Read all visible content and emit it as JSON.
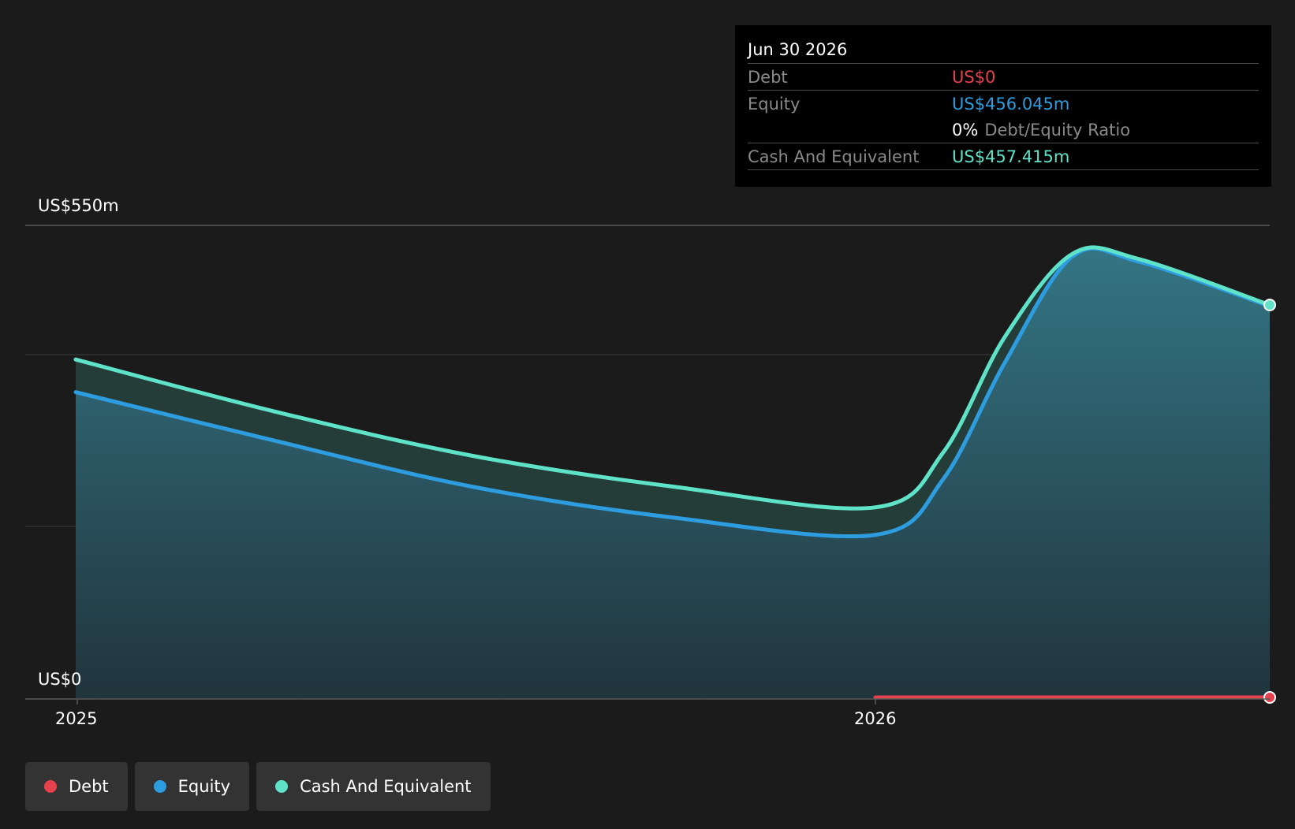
{
  "tooltip": {
    "date": "Jun 30 2026",
    "debt_label": "Debt",
    "debt_value": "US$0",
    "equity_label": "Equity",
    "equity_value": "US$456.045m",
    "ratio_value": "0%",
    "ratio_label": "Debt/Equity Ratio",
    "cash_label": "Cash And Equivalent",
    "cash_value": "US$457.415m"
  },
  "legend": {
    "debt": "Debt",
    "equity": "Equity",
    "cash": "Cash And Equivalent"
  },
  "colors": {
    "debt": "#e5414d",
    "equity": "#2d9de0",
    "cash": "#5fe3c8",
    "background": "#1b1b1b"
  },
  "chart_data": {
    "type": "area",
    "y_tick_labels": [
      "US$550m",
      "US$0"
    ],
    "x_tick_labels": [
      "2025",
      "2026"
    ],
    "x": [
      "2025-01-01",
      "2025-04-01",
      "2025-07-01",
      "2025-10-01",
      "2026-01-01",
      "2026-02-01",
      "2026-03-01",
      "2026-04-01",
      "2026-05-01",
      "2026-06-30"
    ],
    "ylim": [
      0,
      550
    ],
    "grid": true,
    "series": [
      {
        "name": "Debt",
        "values": [
          null,
          null,
          null,
          null,
          0,
          0,
          0,
          0,
          0,
          0
        ]
      },
      {
        "name": "Equity",
        "values": [
          356,
          300,
          246,
          210,
          190,
          255,
          390,
          514,
          508,
          456.045
        ]
      },
      {
        "name": "Cash And Equivalent",
        "values": [
          394,
          334,
          282,
          246,
          222,
          286,
          420,
          517,
          511,
          457.415
        ]
      }
    ]
  }
}
